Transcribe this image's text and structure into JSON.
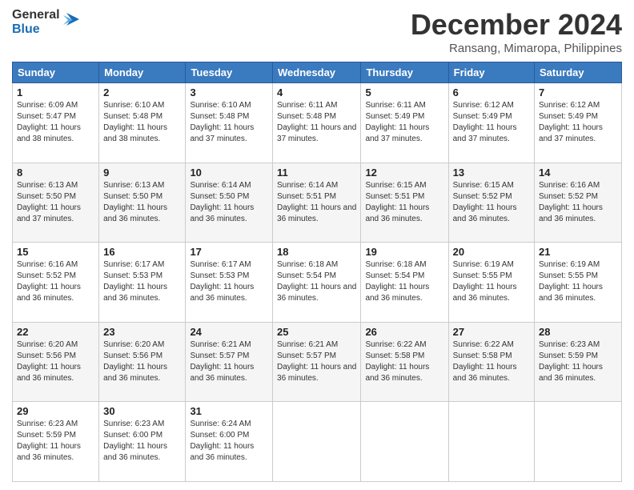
{
  "header": {
    "logo_general": "General",
    "logo_blue": "Blue",
    "month_title": "December 2024",
    "location": "Ransang, Mimaropa, Philippines"
  },
  "days_of_week": [
    "Sunday",
    "Monday",
    "Tuesday",
    "Wednesday",
    "Thursday",
    "Friday",
    "Saturday"
  ],
  "weeks": [
    [
      {
        "day": "1",
        "sunrise": "6:09 AM",
        "sunset": "5:47 PM",
        "daylight": "11 hours and 38 minutes."
      },
      {
        "day": "2",
        "sunrise": "6:10 AM",
        "sunset": "5:48 PM",
        "daylight": "11 hours and 38 minutes."
      },
      {
        "day": "3",
        "sunrise": "6:10 AM",
        "sunset": "5:48 PM",
        "daylight": "11 hours and 37 minutes."
      },
      {
        "day": "4",
        "sunrise": "6:11 AM",
        "sunset": "5:48 PM",
        "daylight": "11 hours and 37 minutes."
      },
      {
        "day": "5",
        "sunrise": "6:11 AM",
        "sunset": "5:49 PM",
        "daylight": "11 hours and 37 minutes."
      },
      {
        "day": "6",
        "sunrise": "6:12 AM",
        "sunset": "5:49 PM",
        "daylight": "11 hours and 37 minutes."
      },
      {
        "day": "7",
        "sunrise": "6:12 AM",
        "sunset": "5:49 PM",
        "daylight": "11 hours and 37 minutes."
      }
    ],
    [
      {
        "day": "8",
        "sunrise": "6:13 AM",
        "sunset": "5:50 PM",
        "daylight": "11 hours and 37 minutes."
      },
      {
        "day": "9",
        "sunrise": "6:13 AM",
        "sunset": "5:50 PM",
        "daylight": "11 hours and 36 minutes."
      },
      {
        "day": "10",
        "sunrise": "6:14 AM",
        "sunset": "5:50 PM",
        "daylight": "11 hours and 36 minutes."
      },
      {
        "day": "11",
        "sunrise": "6:14 AM",
        "sunset": "5:51 PM",
        "daylight": "11 hours and 36 minutes."
      },
      {
        "day": "12",
        "sunrise": "6:15 AM",
        "sunset": "5:51 PM",
        "daylight": "11 hours and 36 minutes."
      },
      {
        "day": "13",
        "sunrise": "6:15 AM",
        "sunset": "5:52 PM",
        "daylight": "11 hours and 36 minutes."
      },
      {
        "day": "14",
        "sunrise": "6:16 AM",
        "sunset": "5:52 PM",
        "daylight": "11 hours and 36 minutes."
      }
    ],
    [
      {
        "day": "15",
        "sunrise": "6:16 AM",
        "sunset": "5:52 PM",
        "daylight": "11 hours and 36 minutes."
      },
      {
        "day": "16",
        "sunrise": "6:17 AM",
        "sunset": "5:53 PM",
        "daylight": "11 hours and 36 minutes."
      },
      {
        "day": "17",
        "sunrise": "6:17 AM",
        "sunset": "5:53 PM",
        "daylight": "11 hours and 36 minutes."
      },
      {
        "day": "18",
        "sunrise": "6:18 AM",
        "sunset": "5:54 PM",
        "daylight": "11 hours and 36 minutes."
      },
      {
        "day": "19",
        "sunrise": "6:18 AM",
        "sunset": "5:54 PM",
        "daylight": "11 hours and 36 minutes."
      },
      {
        "day": "20",
        "sunrise": "6:19 AM",
        "sunset": "5:55 PM",
        "daylight": "11 hours and 36 minutes."
      },
      {
        "day": "21",
        "sunrise": "6:19 AM",
        "sunset": "5:55 PM",
        "daylight": "11 hours and 36 minutes."
      }
    ],
    [
      {
        "day": "22",
        "sunrise": "6:20 AM",
        "sunset": "5:56 PM",
        "daylight": "11 hours and 36 minutes."
      },
      {
        "day": "23",
        "sunrise": "6:20 AM",
        "sunset": "5:56 PM",
        "daylight": "11 hours and 36 minutes."
      },
      {
        "day": "24",
        "sunrise": "6:21 AM",
        "sunset": "5:57 PM",
        "daylight": "11 hours and 36 minutes."
      },
      {
        "day": "25",
        "sunrise": "6:21 AM",
        "sunset": "5:57 PM",
        "daylight": "11 hours and 36 minutes."
      },
      {
        "day": "26",
        "sunrise": "6:22 AM",
        "sunset": "5:58 PM",
        "daylight": "11 hours and 36 minutes."
      },
      {
        "day": "27",
        "sunrise": "6:22 AM",
        "sunset": "5:58 PM",
        "daylight": "11 hours and 36 minutes."
      },
      {
        "day": "28",
        "sunrise": "6:23 AM",
        "sunset": "5:59 PM",
        "daylight": "11 hours and 36 minutes."
      }
    ],
    [
      {
        "day": "29",
        "sunrise": "6:23 AM",
        "sunset": "5:59 PM",
        "daylight": "11 hours and 36 minutes."
      },
      {
        "day": "30",
        "sunrise": "6:23 AM",
        "sunset": "6:00 PM",
        "daylight": "11 hours and 36 minutes."
      },
      {
        "day": "31",
        "sunrise": "6:24 AM",
        "sunset": "6:00 PM",
        "daylight": "11 hours and 36 minutes."
      },
      null,
      null,
      null,
      null
    ]
  ]
}
